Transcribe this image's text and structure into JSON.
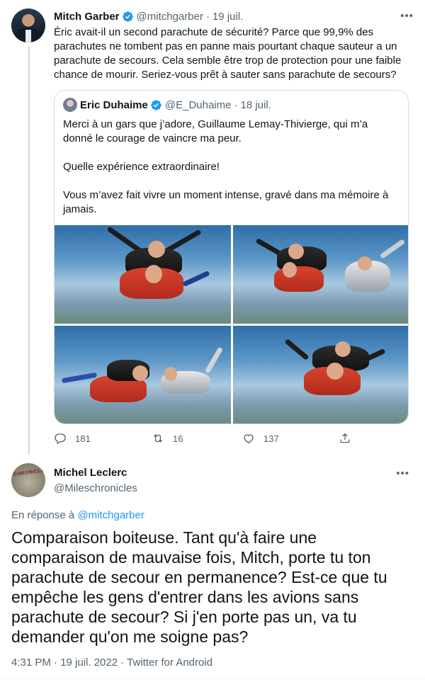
{
  "tweet": {
    "name": "Mitch Garber",
    "handle": "@mitchgarber",
    "separator": "·",
    "date": "19 juil.",
    "text": "Éric avait-il un second parachute de sécurité? Parce que 99,9% des parachutes ne tombent pas en panne mais pourtant chaque sauteur a un parachute de secours. Cela semble être trop de protection pour une faible chance de mourir. Seriez-vous prêt à sauter sans parachute de secours?",
    "more": "•••"
  },
  "quote": {
    "name": "Eric Duhaime",
    "handle": "@E_Duhaime",
    "separator": "·",
    "date": "18 juil.",
    "paragraphs": [
      "Merci à un gars que j’adore, Guillaume Lemay-Thivierge, qui m’a donné le courage de vaincre ma peur.",
      "Quelle expérience extraordinaire!",
      "Vous m’avez fait vivre un moment intense, gravé dans ma mémoire à jamais."
    ]
  },
  "actions": {
    "replies": "181",
    "retweets": "16",
    "likes": "137"
  },
  "reply": {
    "name": "Michel Leclerc",
    "handle": "@Mileschronicles",
    "avatar_text": "CHRONICLE",
    "more": "•••",
    "reply_prefix": "En réponse à",
    "reply_to": "@mitchgarber",
    "text": "Comparaison boiteuse. Tant qu'à faire une comparaison de mauvaise fois, Mitch, porte tu ton parachute de secour en permanence? Est-ce que tu empêche les gens d'entrer dans les avions sans parachute de secour? Si j'en porte pas un, va tu demander qu'on me soigne pas?",
    "meta": "4:31 PM · 19 juil. 2022 · Twitter for Android"
  },
  "colors": {
    "accent": "#1d9bf0",
    "secondary_text": "#536471",
    "border": "#cfd9de"
  },
  "icons": [
    "verified-badge-icon",
    "reply-icon",
    "retweet-icon",
    "like-icon",
    "share-icon",
    "more-icon"
  ]
}
